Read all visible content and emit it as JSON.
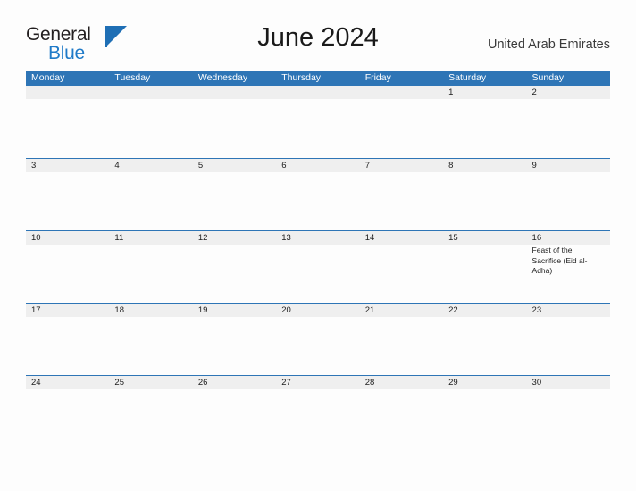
{
  "brand": {
    "name_part1": "General",
    "name_part2": "Blue",
    "logo_icon": "general-blue-flag-logo",
    "color_dark": "#231f20",
    "color_blue": "#1f7ac8"
  },
  "header": {
    "title": "June 2024",
    "region": "United Arab Emirates",
    "accent_color": "#2e75b6",
    "band_color": "#efefef"
  },
  "calendar": {
    "day_names": [
      "Monday",
      "Tuesday",
      "Wednesday",
      "Thursday",
      "Friday",
      "Saturday",
      "Sunday"
    ],
    "weeks": [
      {
        "days": [
          {
            "num": "",
            "event": ""
          },
          {
            "num": "",
            "event": ""
          },
          {
            "num": "",
            "event": ""
          },
          {
            "num": "",
            "event": ""
          },
          {
            "num": "",
            "event": ""
          },
          {
            "num": "1",
            "event": ""
          },
          {
            "num": "2",
            "event": ""
          }
        ]
      },
      {
        "days": [
          {
            "num": "3",
            "event": ""
          },
          {
            "num": "4",
            "event": ""
          },
          {
            "num": "5",
            "event": ""
          },
          {
            "num": "6",
            "event": ""
          },
          {
            "num": "7",
            "event": ""
          },
          {
            "num": "8",
            "event": ""
          },
          {
            "num": "9",
            "event": ""
          }
        ]
      },
      {
        "days": [
          {
            "num": "10",
            "event": ""
          },
          {
            "num": "11",
            "event": ""
          },
          {
            "num": "12",
            "event": ""
          },
          {
            "num": "13",
            "event": ""
          },
          {
            "num": "14",
            "event": ""
          },
          {
            "num": "15",
            "event": ""
          },
          {
            "num": "16",
            "event": "Feast of the Sacrifice (Eid al-Adha)"
          }
        ]
      },
      {
        "days": [
          {
            "num": "17",
            "event": ""
          },
          {
            "num": "18",
            "event": ""
          },
          {
            "num": "19",
            "event": ""
          },
          {
            "num": "20",
            "event": ""
          },
          {
            "num": "21",
            "event": ""
          },
          {
            "num": "22",
            "event": ""
          },
          {
            "num": "23",
            "event": ""
          }
        ]
      },
      {
        "days": [
          {
            "num": "24",
            "event": ""
          },
          {
            "num": "25",
            "event": ""
          },
          {
            "num": "26",
            "event": ""
          },
          {
            "num": "27",
            "event": ""
          },
          {
            "num": "28",
            "event": ""
          },
          {
            "num": "29",
            "event": ""
          },
          {
            "num": "30",
            "event": ""
          }
        ]
      }
    ]
  }
}
